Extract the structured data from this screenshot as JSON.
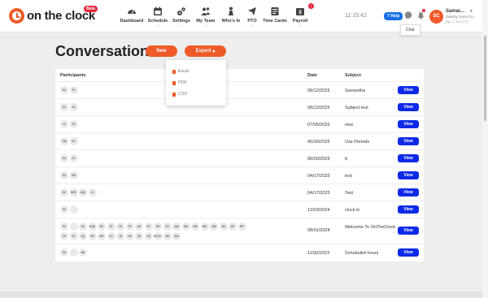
{
  "logo": {
    "text_on": "on the",
    "text_clock": "clock",
    "beta": "Beta"
  },
  "nav": [
    {
      "label": "Dashboard",
      "icon": "dashboard-icon",
      "caret": ""
    },
    {
      "label": "Schedule",
      "icon": "calendar-icon",
      "caret": "⌄"
    },
    {
      "label": "Settings",
      "icon": "gear-icon",
      "caret": "⌄"
    },
    {
      "label": "My Team",
      "icon": "team-icon",
      "caret": "⌄"
    },
    {
      "label": "Who's In",
      "icon": "whos-in-icon",
      "caret": ""
    },
    {
      "label": "PTO",
      "icon": "plane-icon",
      "caret": "⌄"
    },
    {
      "label": "Time Cards",
      "icon": "time-card-icon",
      "caret": ""
    },
    {
      "label": "Payroll",
      "icon": "payroll-icon",
      "caret": "⌄",
      "badge": "1"
    }
  ],
  "header": {
    "time": "11:15:42",
    "help": "? Help",
    "tooltip": "Chat"
  },
  "user": {
    "initials": "SC",
    "name": "Samar...",
    "company": "Sammy Suns Co...",
    "id": "(No. 1,113,177)"
  },
  "page": {
    "title": "Conversations",
    "new_label": "New",
    "export_label": "Export ▴"
  },
  "export_menu": [
    {
      "label": "Excel"
    },
    {
      "label": "PDF"
    },
    {
      "label": "CSV"
    }
  ],
  "table": {
    "headers": {
      "participants": "Participants",
      "date": "Date",
      "subject": "Subject"
    },
    "view_label": "View",
    "rows": [
      {
        "participants": [
          "SC",
          "TE"
        ],
        "date": "08/12/2025",
        "subject": "Samantha"
      },
      {
        "participants": [
          "SC",
          "JG"
        ],
        "date": "08/12/2025",
        "subject": "Subject test"
      },
      {
        "participants": [
          "JC",
          "SC"
        ],
        "date": "07/05/2025",
        "subject": "new"
      },
      {
        "participants": [
          "SM",
          "SC"
        ],
        "date": "06/30/2025",
        "subject": "Use Periods"
      },
      {
        "participants": [
          "SC",
          "JC"
        ],
        "date": "06/30/2025",
        "subject": "tt"
      },
      {
        "participants": [
          "SC",
          "SM"
        ],
        "date": "04/17/2025",
        "subject": "test"
      },
      {
        "participants": [
          "SC",
          "NEE",
          "AQE",
          "JC"
        ],
        "date": "04/17/2025",
        "subject": "Test"
      },
      {
        "participants": [
          "SC",
          ""
        ],
        "date": "12/03/2024",
        "subject": "clock in"
      },
      {
        "participants": [
          "SC",
          "",
          "SC",
          "AQE",
          "EE",
          "TE",
          "TE",
          "TE",
          "AE",
          "JG",
          "SH",
          "VK",
          "AM",
          "SM",
          "BM",
          "DM",
          "AM",
          "JM",
          "NP",
          "BP",
          "CP",
          "VP",
          "SQ",
          "ER",
          "MR",
          "JS",
          "JS",
          "NS",
          "SS",
          "OS",
          "WTG1",
          "JW",
          "SW"
        ],
        "date": "08/01/2024",
        "subject": "Welcome To OnTheClock"
      },
      {
        "participants": [
          "SC",
          "",
          "NE"
        ],
        "date": "11/20/2023",
        "subject": "Scheduled hours"
      }
    ]
  }
}
